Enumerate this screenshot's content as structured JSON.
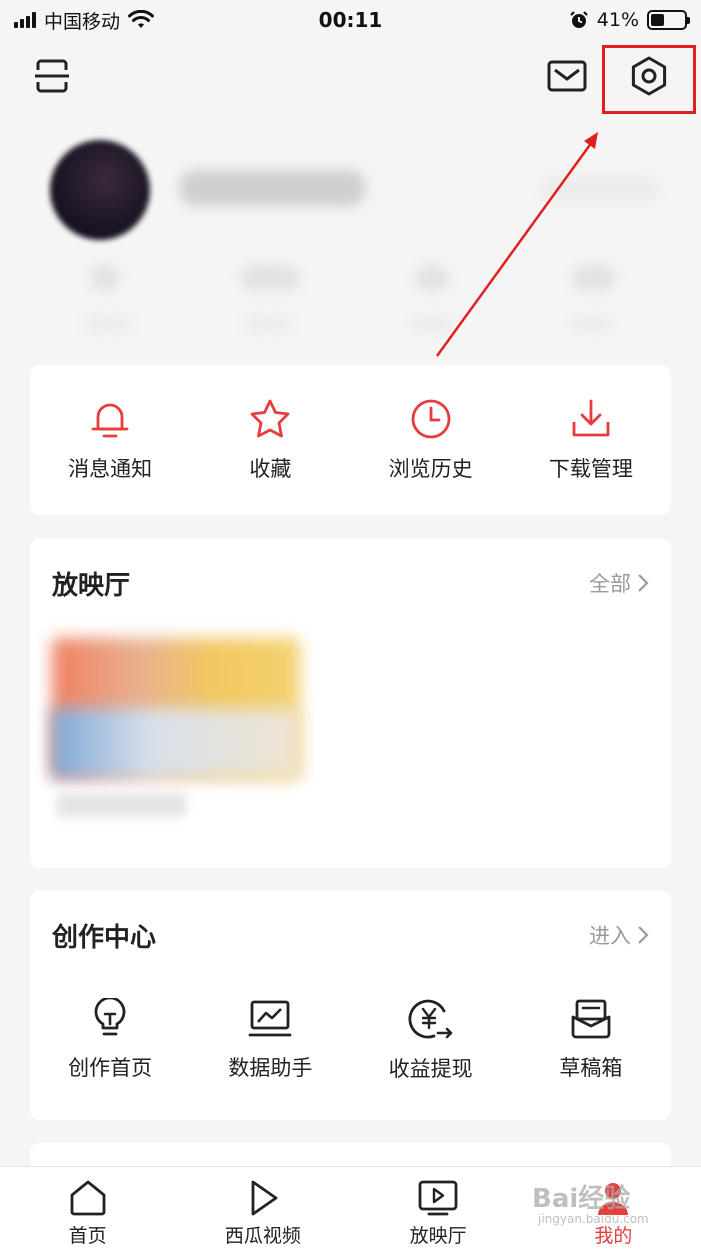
{
  "status_bar": {
    "carrier": "中国移动",
    "time": "00:11",
    "battery_percent": "41%",
    "battery_level": 0.41,
    "icons": [
      "signal-icon",
      "wifi-icon",
      "alarm-icon",
      "battery-icon"
    ]
  },
  "top_nav": {
    "icons": [
      "scan-icon",
      "mail-icon",
      "settings-icon"
    ],
    "annotation_color": "#e02020"
  },
  "quick_actions": [
    {
      "label": "消息通知",
      "icon": "bell-icon"
    },
    {
      "label": "收藏",
      "icon": "star-icon"
    },
    {
      "label": "浏览历史",
      "icon": "clock-icon"
    },
    {
      "label": "下载管理",
      "icon": "download-icon"
    }
  ],
  "screening_hall": {
    "title": "放映厅",
    "more_label": "全部"
  },
  "creator_center": {
    "title": "创作中心",
    "more_label": "进入",
    "items": [
      {
        "label": "创作首页",
        "icon": "lightbulb-icon"
      },
      {
        "label": "数据助手",
        "icon": "chart-monitor-icon"
      },
      {
        "label": "收益提现",
        "icon": "yen-arrow-icon"
      },
      {
        "label": "草稿箱",
        "icon": "draft-box-icon"
      }
    ]
  },
  "tab_bar": {
    "tabs": [
      {
        "label": "首页",
        "icon": "home-icon"
      },
      {
        "label": "西瓜视频",
        "icon": "play-icon"
      },
      {
        "label": "放映厅",
        "icon": "tv-play-icon"
      },
      {
        "label": "我的",
        "icon": "profile-icon",
        "active": true
      }
    ]
  },
  "watermark": {
    "text": "Bai经验",
    "sub": "jingyan.baidu.com"
  },
  "colors": {
    "accent": "#e63c3c",
    "background": "#f5f5f5"
  }
}
